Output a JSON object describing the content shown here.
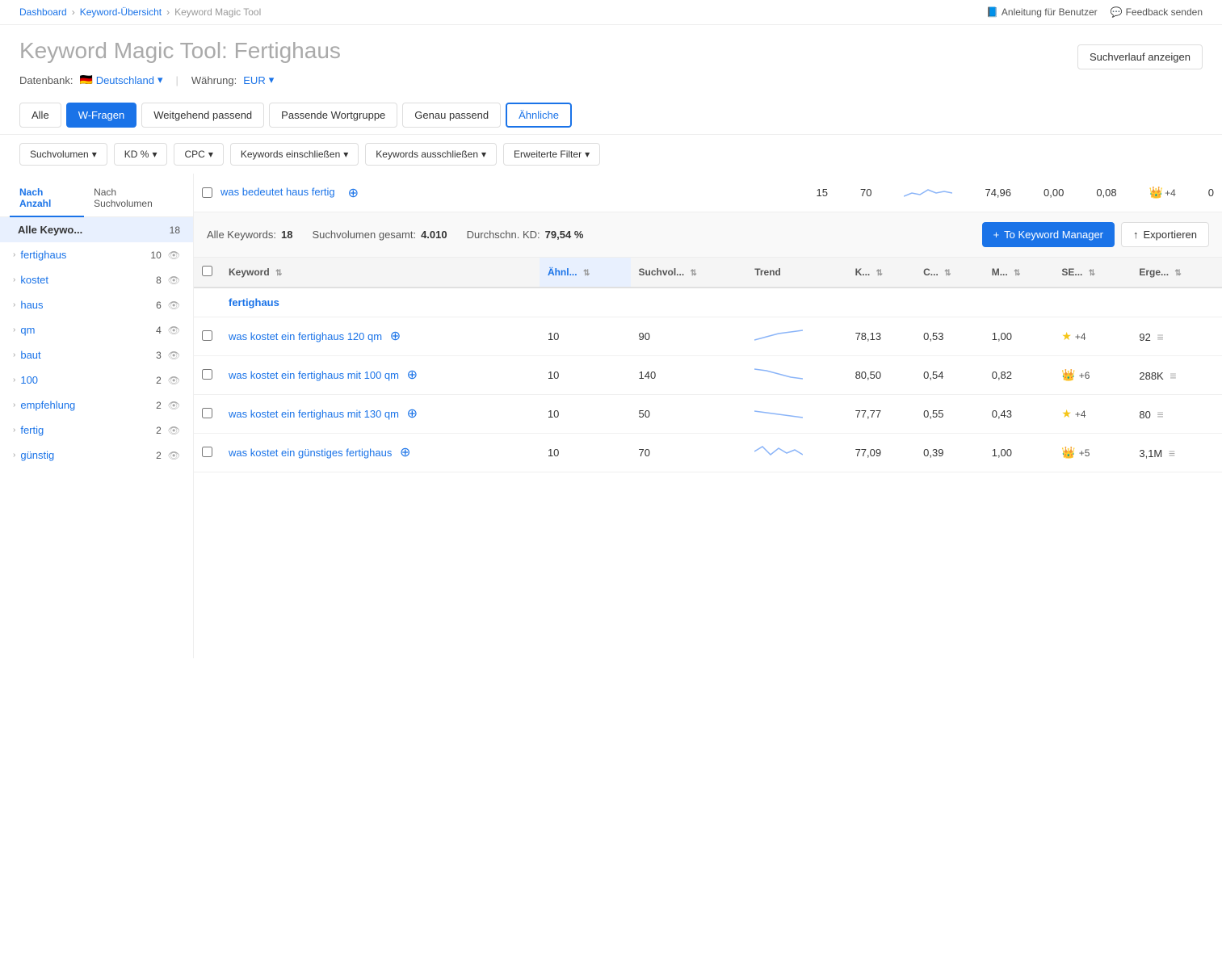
{
  "breadcrumb": {
    "items": [
      "Dashboard",
      "Keyword-Übersicht",
      "Keyword Magic Tool"
    ]
  },
  "top_actions": {
    "guide": "Anleitung für Benutzer",
    "feedback": "Feedback senden"
  },
  "header": {
    "title_prefix": "Keyword Magic Tool:",
    "title_keyword": "Fertighaus",
    "search_history_btn": "Suchverlauf anzeigen"
  },
  "database": {
    "label": "Datenbank:",
    "value": "Deutschland",
    "currency_label": "Währung:",
    "currency_value": "EUR"
  },
  "tabs": [
    {
      "id": "alle",
      "label": "Alle",
      "active": false
    },
    {
      "id": "w-fragen",
      "label": "W-Fragen",
      "active": true
    },
    {
      "id": "weitgehend",
      "label": "Weitgehend passend",
      "active": false
    },
    {
      "id": "passende",
      "label": "Passende Wortgruppe",
      "active": false
    },
    {
      "id": "genau",
      "label": "Genau passend",
      "active": false
    },
    {
      "id": "aehnliche",
      "label": "Ähnliche",
      "active": false
    }
  ],
  "filters": [
    {
      "id": "suchvolumen",
      "label": "Suchvolumen"
    },
    {
      "id": "kd",
      "label": "KD %"
    },
    {
      "id": "cpc",
      "label": "CPC"
    },
    {
      "id": "keywords-ein",
      "label": "Keywords einschließen"
    },
    {
      "id": "keywords-aus",
      "label": "Keywords ausschließen"
    },
    {
      "id": "erweitert",
      "label": "Erweiterte Filter"
    }
  ],
  "sidebar": {
    "tab_count": "Nach Anzahl",
    "tab_volume": "Nach Suchvolumen",
    "items": [
      {
        "id": "alle",
        "name": "Alle Keywo...",
        "count": 18,
        "active": true
      },
      {
        "id": "fertighaus",
        "name": "fertighaus",
        "count": 10,
        "active": false
      },
      {
        "id": "kostet",
        "name": "kostet",
        "count": 8,
        "active": false
      },
      {
        "id": "haus",
        "name": "haus",
        "count": 6,
        "active": false
      },
      {
        "id": "qm",
        "name": "qm",
        "count": 4,
        "active": false
      },
      {
        "id": "baut",
        "name": "baut",
        "count": 3,
        "active": false
      },
      {
        "id": "100",
        "name": "100",
        "count": 2,
        "active": false
      },
      {
        "id": "empfehlung",
        "name": "empfehlung",
        "count": 2,
        "active": false
      },
      {
        "id": "fertig",
        "name": "fertig",
        "count": 2,
        "active": false
      },
      {
        "id": "guenstig",
        "name": "günstig",
        "count": 2,
        "active": false
      }
    ]
  },
  "stats": {
    "all_keywords_label": "Alle Keywords:",
    "all_keywords_value": "18",
    "suchvolumen_label": "Suchvolumen gesamt:",
    "suchvolumen_value": "4.010",
    "kd_label": "Durchschn. KD:",
    "kd_value": "79,54 %",
    "btn_keyword_manager": "To Keyword Manager",
    "btn_export": "Exportieren"
  },
  "table": {
    "columns": [
      {
        "id": "keyword",
        "label": "Keyword"
      },
      {
        "id": "aehnl",
        "label": "Ähnl...",
        "sorted": true
      },
      {
        "id": "suchvol",
        "label": "Suchvol..."
      },
      {
        "id": "trend",
        "label": "Trend"
      },
      {
        "id": "k",
        "label": "K..."
      },
      {
        "id": "c",
        "label": "C..."
      },
      {
        "id": "m",
        "label": "M..."
      },
      {
        "id": "se",
        "label": "SE..."
      },
      {
        "id": "erge",
        "label": "Erge..."
      }
    ],
    "partial_row": {
      "keyword": "was bedeutet haus fertig",
      "aehnl": "15",
      "suchvol": "70",
      "trend": "flat",
      "k": "74,96",
      "c": "0,00",
      "m": "0,08",
      "sf_type": "crown",
      "sf_count": "+4",
      "erge": "0"
    },
    "rows": [
      {
        "keyword": "fertighaus",
        "keyword_partial": "",
        "aehnl": "",
        "suchvol": "",
        "trend": "",
        "k": "",
        "c": "",
        "m": "",
        "sf_type": "",
        "sf_count": "",
        "erge": ""
      },
      {
        "keyword": "was kostet ein fertighaus 120 qm",
        "aehnl": "10",
        "suchvol": "90",
        "trend": "up",
        "k": "78,13",
        "c": "0,53",
        "m": "1,00",
        "sf_type": "star",
        "sf_count": "+4",
        "erge": "92"
      },
      {
        "keyword": "was kostet ein fertighaus mit 100 qm",
        "aehnl": "10",
        "suchvol": "140",
        "trend": "down",
        "k": "80,50",
        "c": "0,54",
        "m": "0,82",
        "sf_type": "crown",
        "sf_count": "+6",
        "erge": "288K"
      },
      {
        "keyword": "was kostet ein fertighaus mit 130 qm",
        "aehnl": "10",
        "suchvol": "50",
        "trend": "slight-down",
        "k": "77,77",
        "c": "0,55",
        "m": "0,43",
        "sf_type": "star",
        "sf_count": "+4",
        "erge": "80"
      },
      {
        "keyword": "was kostet ein günstiges fertighaus",
        "aehnl": "10",
        "suchvol": "70",
        "trend": "volatile",
        "k": "77,09",
        "c": "0,39",
        "m": "1,00",
        "sf_type": "crown",
        "sf_count": "+5",
        "erge": "3,1M"
      }
    ]
  }
}
